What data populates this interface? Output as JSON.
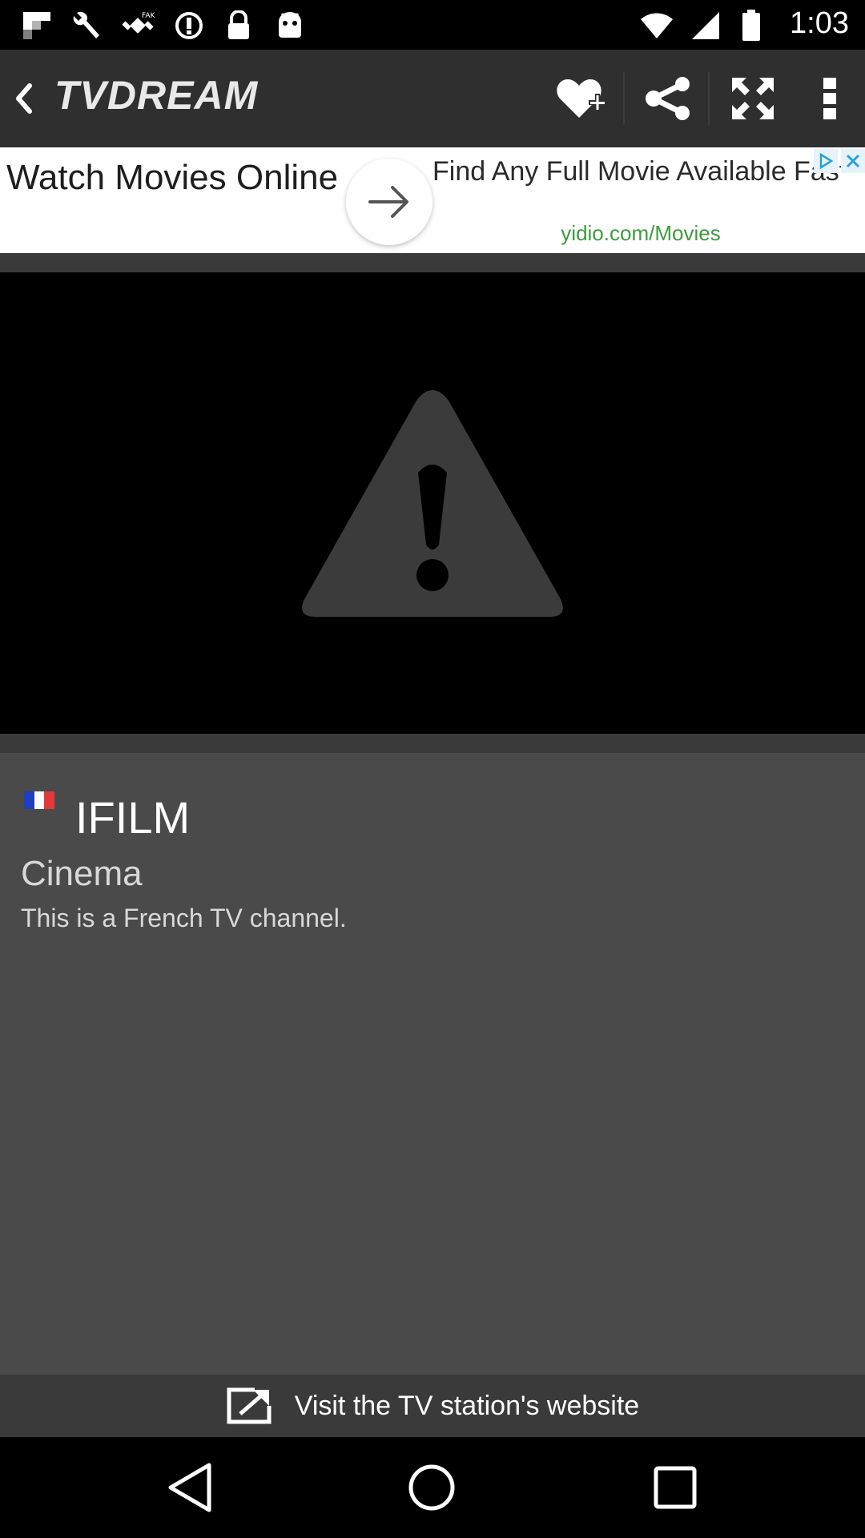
{
  "status_bar": {
    "time": "1:03",
    "icons": [
      "flipboard-icon",
      "wrench-icon",
      "fake-gps-icon",
      "alert-circle-icon",
      "lock-icon",
      "android-icon"
    ]
  },
  "app_bar": {
    "logo": "TVDREAM",
    "actions": [
      "heart-plus-icon",
      "share-icon",
      "fullscreen-icon",
      "more-vert-icon"
    ]
  },
  "ad": {
    "left_text": "Watch Movies Online",
    "headline": "Find Any Full Movie Available Fast and Easy.",
    "domain": "yidio.com/Movies"
  },
  "player": {
    "state_icon": "warning-icon"
  },
  "channel": {
    "flag_colors": [
      "#1f3fbf",
      "#ffffff",
      "#e23a3a"
    ],
    "name": "IFILM",
    "category": "Cinema",
    "description": "This is a French TV channel."
  },
  "website": {
    "label": "Visit the TV station's website"
  },
  "nav": [
    "back-icon",
    "home-icon",
    "recents-icon"
  ]
}
